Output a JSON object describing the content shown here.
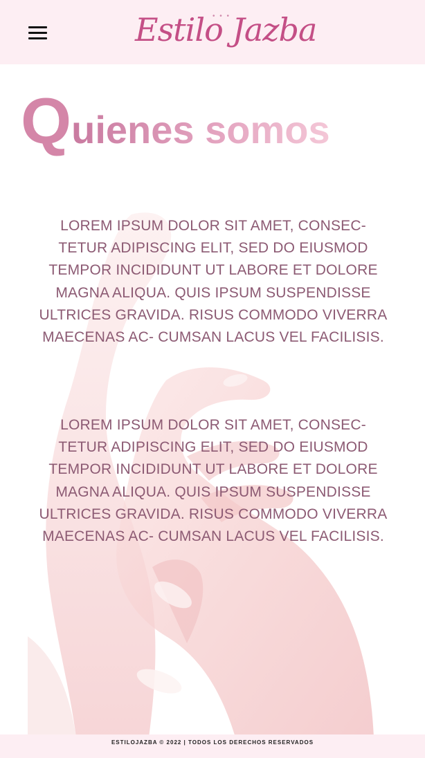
{
  "header": {
    "logo_text": "Estilo Jazba",
    "logo_dots": "• • •",
    "menu_icon": "hamburger-menu-icon"
  },
  "main": {
    "title_cap": "Q",
    "title_rest": "uienes somos",
    "paragraphs": [
      "LOREM IPSUM DOLOR SIT AMET, CONSEC- TETUR ADIPISCING ELIT, SED DO EIUSMOD TEMPOR INCIDIDUNT UT LABORE ET DOLORE MAGNA ALIQUA. QUIS IPSUM SUSPENDISSE ULTRICES GRAVIDA. RISUS COMMODO VIVERRA MAECENAS AC- CUMSAN LACUS VEL FACILISIS.",
      "LOREM IPSUM DOLOR SIT AMET, CONSEC- TETUR ADIPISCING ELIT, SED DO EIUSMOD TEMPOR INCIDIDUNT UT LABORE ET DOLORE MAGNA ALIQUA. QUIS IPSUM SUSPENDISSE ULTRICES GRAVIDA. RISUS COMMODO VIVERRA MAECENAS AC- CUMSAN LACUS VEL FACILISIS."
    ]
  },
  "footer": {
    "text": "ESTILOJAZBA © 2022 | TODOS LOS DERECHOS RESERVADOS"
  },
  "colors": {
    "header_bg": "#fdeef3",
    "brand_pink": "#c44f86",
    "title_pink": "#d486a8",
    "body_text": "#8c5a73"
  }
}
